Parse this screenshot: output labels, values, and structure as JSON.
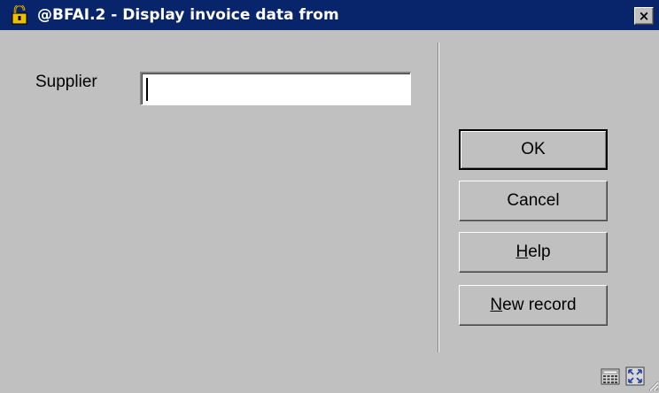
{
  "window": {
    "title": "@BFAI.2 - Display invoice data from",
    "icon": "padlock-icon",
    "close_icon": "close-icon",
    "close_symbol": "×"
  },
  "form": {
    "supplier_label": "Supplier",
    "supplier_value": ""
  },
  "buttons": {
    "ok": "OK",
    "cancel": "Cancel",
    "help_mnemonic": "H",
    "help_rest": "elp",
    "new_mnemonic": "N",
    "new_rest": "ew record"
  },
  "status_bar": {
    "icons": [
      "calculator-icon",
      "expand-icon",
      "resize-grip-icon"
    ]
  },
  "colors": {
    "titlebar": "#08246b",
    "face": "#c0c0c0",
    "title_text": "#ffffff",
    "padlock": "#f0c000"
  }
}
